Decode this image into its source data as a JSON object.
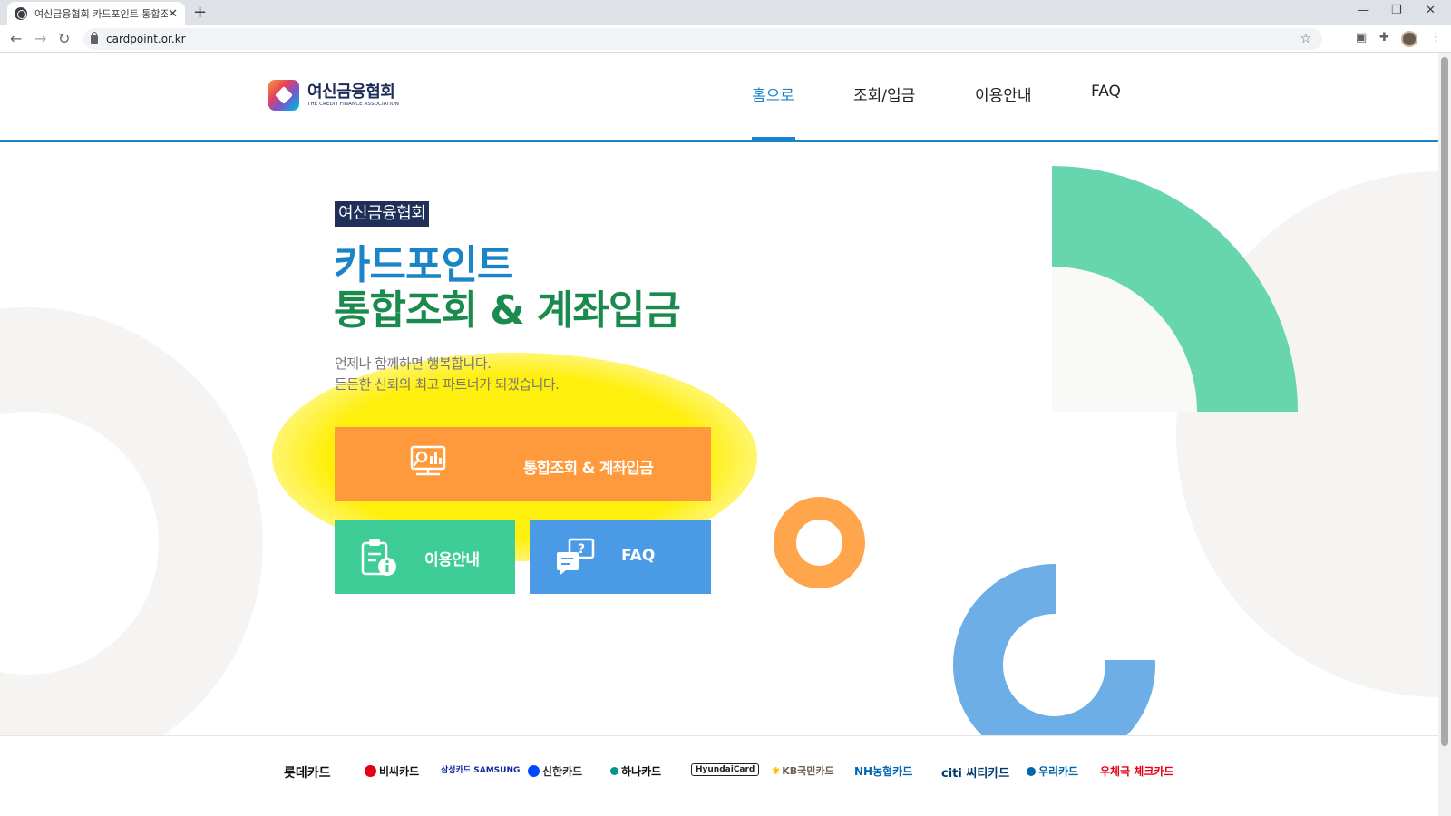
{
  "browser": {
    "tab_title": "여신금융협회 카드포인트 통합조회",
    "new_tab_label": "+",
    "url": "cardpoint.or.kr",
    "window_controls": [
      "minimize-icon",
      "restore-icon",
      "close-icon"
    ]
  },
  "header": {
    "logo_ko": "여신금융협회",
    "logo_en": "THE CREDIT FINANCE ASSOCIATION",
    "nav": [
      {
        "label": "홈으로",
        "active": true
      },
      {
        "label": "조회/입금",
        "active": false
      },
      {
        "label": "이용안내",
        "active": false
      },
      {
        "label": "FAQ",
        "active": false
      }
    ]
  },
  "hero": {
    "badge": "여신금융협회",
    "title_line1": "카드포인트",
    "title_line2": "통합조회 & 계좌입금",
    "sub_line1": "언제나 함께하면 행복합니다.",
    "sub_line2": "든든한 신뢰의 최고 파트너가 되겠습니다."
  },
  "buttons": {
    "main_label": "통합조회 & 계좌입금",
    "guide_label": "이용안내",
    "faq_label": "FAQ"
  },
  "partners": [
    {
      "label": "롯데카드",
      "color": "#111111"
    },
    {
      "label": "비씨카드",
      "color": "#e60012"
    },
    {
      "label": "삼성카드 SAMSUNG",
      "color": "#1428a0"
    },
    {
      "label": "신한카드",
      "color": "#0046ff"
    },
    {
      "label": "하나카드",
      "color": "#009490"
    },
    {
      "label": "HyundaiCard",
      "color": "#222222"
    },
    {
      "label": "KB국민카드",
      "color": "#ffbc00"
    },
    {
      "label": "NH농협카드",
      "color": "#0066b3"
    },
    {
      "label": "citi 씨티카드",
      "color": "#003b70"
    },
    {
      "label": "우리카드",
      "color": "#0067ac"
    },
    {
      "label": "우체국 체크카드",
      "color": "#e60012"
    }
  ],
  "colors": {
    "brand_blue": "#1a84c7",
    "brand_green": "#1a8a4e",
    "main_button": "#ff9a3c",
    "guide_button": "#3ecd96",
    "faq_button": "#4a9ae6",
    "highlight": "#ffee00"
  }
}
